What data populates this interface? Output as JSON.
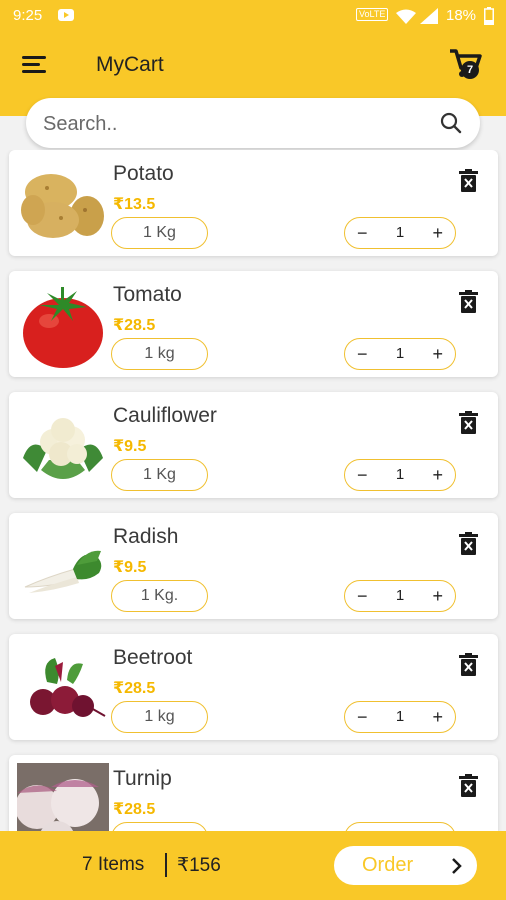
{
  "status_bar": {
    "time": "9:25",
    "network": "VoLTE",
    "battery": "18%"
  },
  "app_bar": {
    "title": "MyCart",
    "cart_count": "7"
  },
  "search": {
    "placeholder": "Search.."
  },
  "products": [
    {
      "name": "Potato",
      "price": "₹13.5",
      "weight": "1 Kg",
      "quantity": "1",
      "image": "potato"
    },
    {
      "name": "Tomato",
      "price": "₹28.5",
      "weight": "1 kg",
      "quantity": "1",
      "image": "tomato"
    },
    {
      "name": "Cauliflower",
      "price": "₹9.5",
      "weight": "1 Kg",
      "quantity": "1",
      "image": "cauliflower"
    },
    {
      "name": "Radish",
      "price": "₹9.5",
      "weight": "1 Kg.",
      "quantity": "1",
      "image": "radish"
    },
    {
      "name": "Beetroot",
      "price": "₹28.5",
      "weight": "1 kg",
      "quantity": "1",
      "image": "beetroot"
    },
    {
      "name": "Turnip",
      "price": "₹28.5",
      "weight": "",
      "quantity": "",
      "image": "turnip"
    }
  ],
  "stepper": {
    "minus": "−",
    "plus": "+"
  },
  "bottom_bar": {
    "items": "7 Items",
    "total": "₹156",
    "order_label": "Order"
  },
  "colors": {
    "accent": "#f9c828",
    "price": "#f5b800"
  }
}
